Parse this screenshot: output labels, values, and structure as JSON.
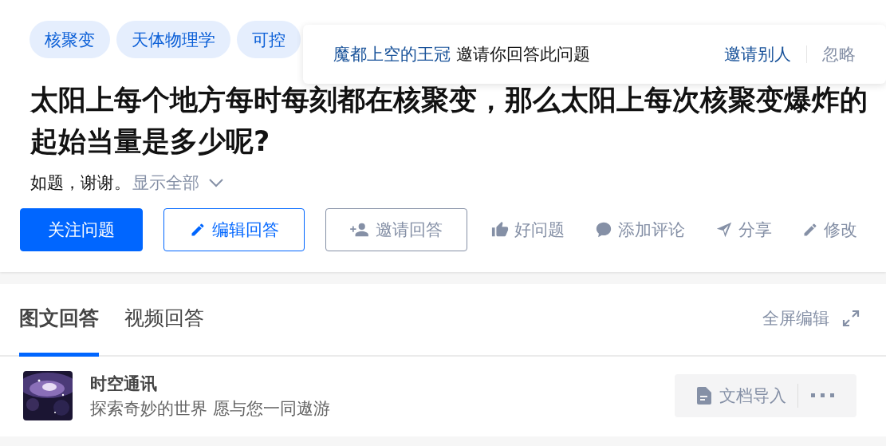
{
  "tags": [
    "核聚变",
    "天体物理学",
    "可控"
  ],
  "invite_popup": {
    "inviter": "魔都上空的王冠",
    "message": "邀请你回答此问题",
    "invite_others": "邀请别人",
    "ignore": "忽略"
  },
  "question": {
    "title": "太阳上每个地方每时每刻都在核聚变，那么太阳上每次核聚变爆炸的起始当量是多少呢?",
    "description": "如题，谢谢。",
    "show_all": "显示全部"
  },
  "buttons": [
    {
      "kind": "primary",
      "label": "关注问题"
    },
    {
      "kind": "outline",
      "label": "编辑回答"
    },
    {
      "kind": "muted",
      "label": "邀请回答"
    }
  ],
  "actions": [
    {
      "kind": "like",
      "label": "好问题"
    },
    {
      "kind": "comment",
      "label": "添加评论"
    },
    {
      "kind": "share",
      "label": "分享"
    },
    {
      "kind": "edit",
      "label": "修改"
    }
  ],
  "answer_tabs": [
    {
      "label": "图文回答",
      "selected": true
    },
    {
      "label": "视频回答",
      "selected": false
    }
  ],
  "fullscreen_edit": "全屏编辑",
  "author": {
    "name": "时空通讯",
    "bio": "探索奇妙的世界 愿与您一同遨游"
  },
  "import_button": "文档导入"
}
